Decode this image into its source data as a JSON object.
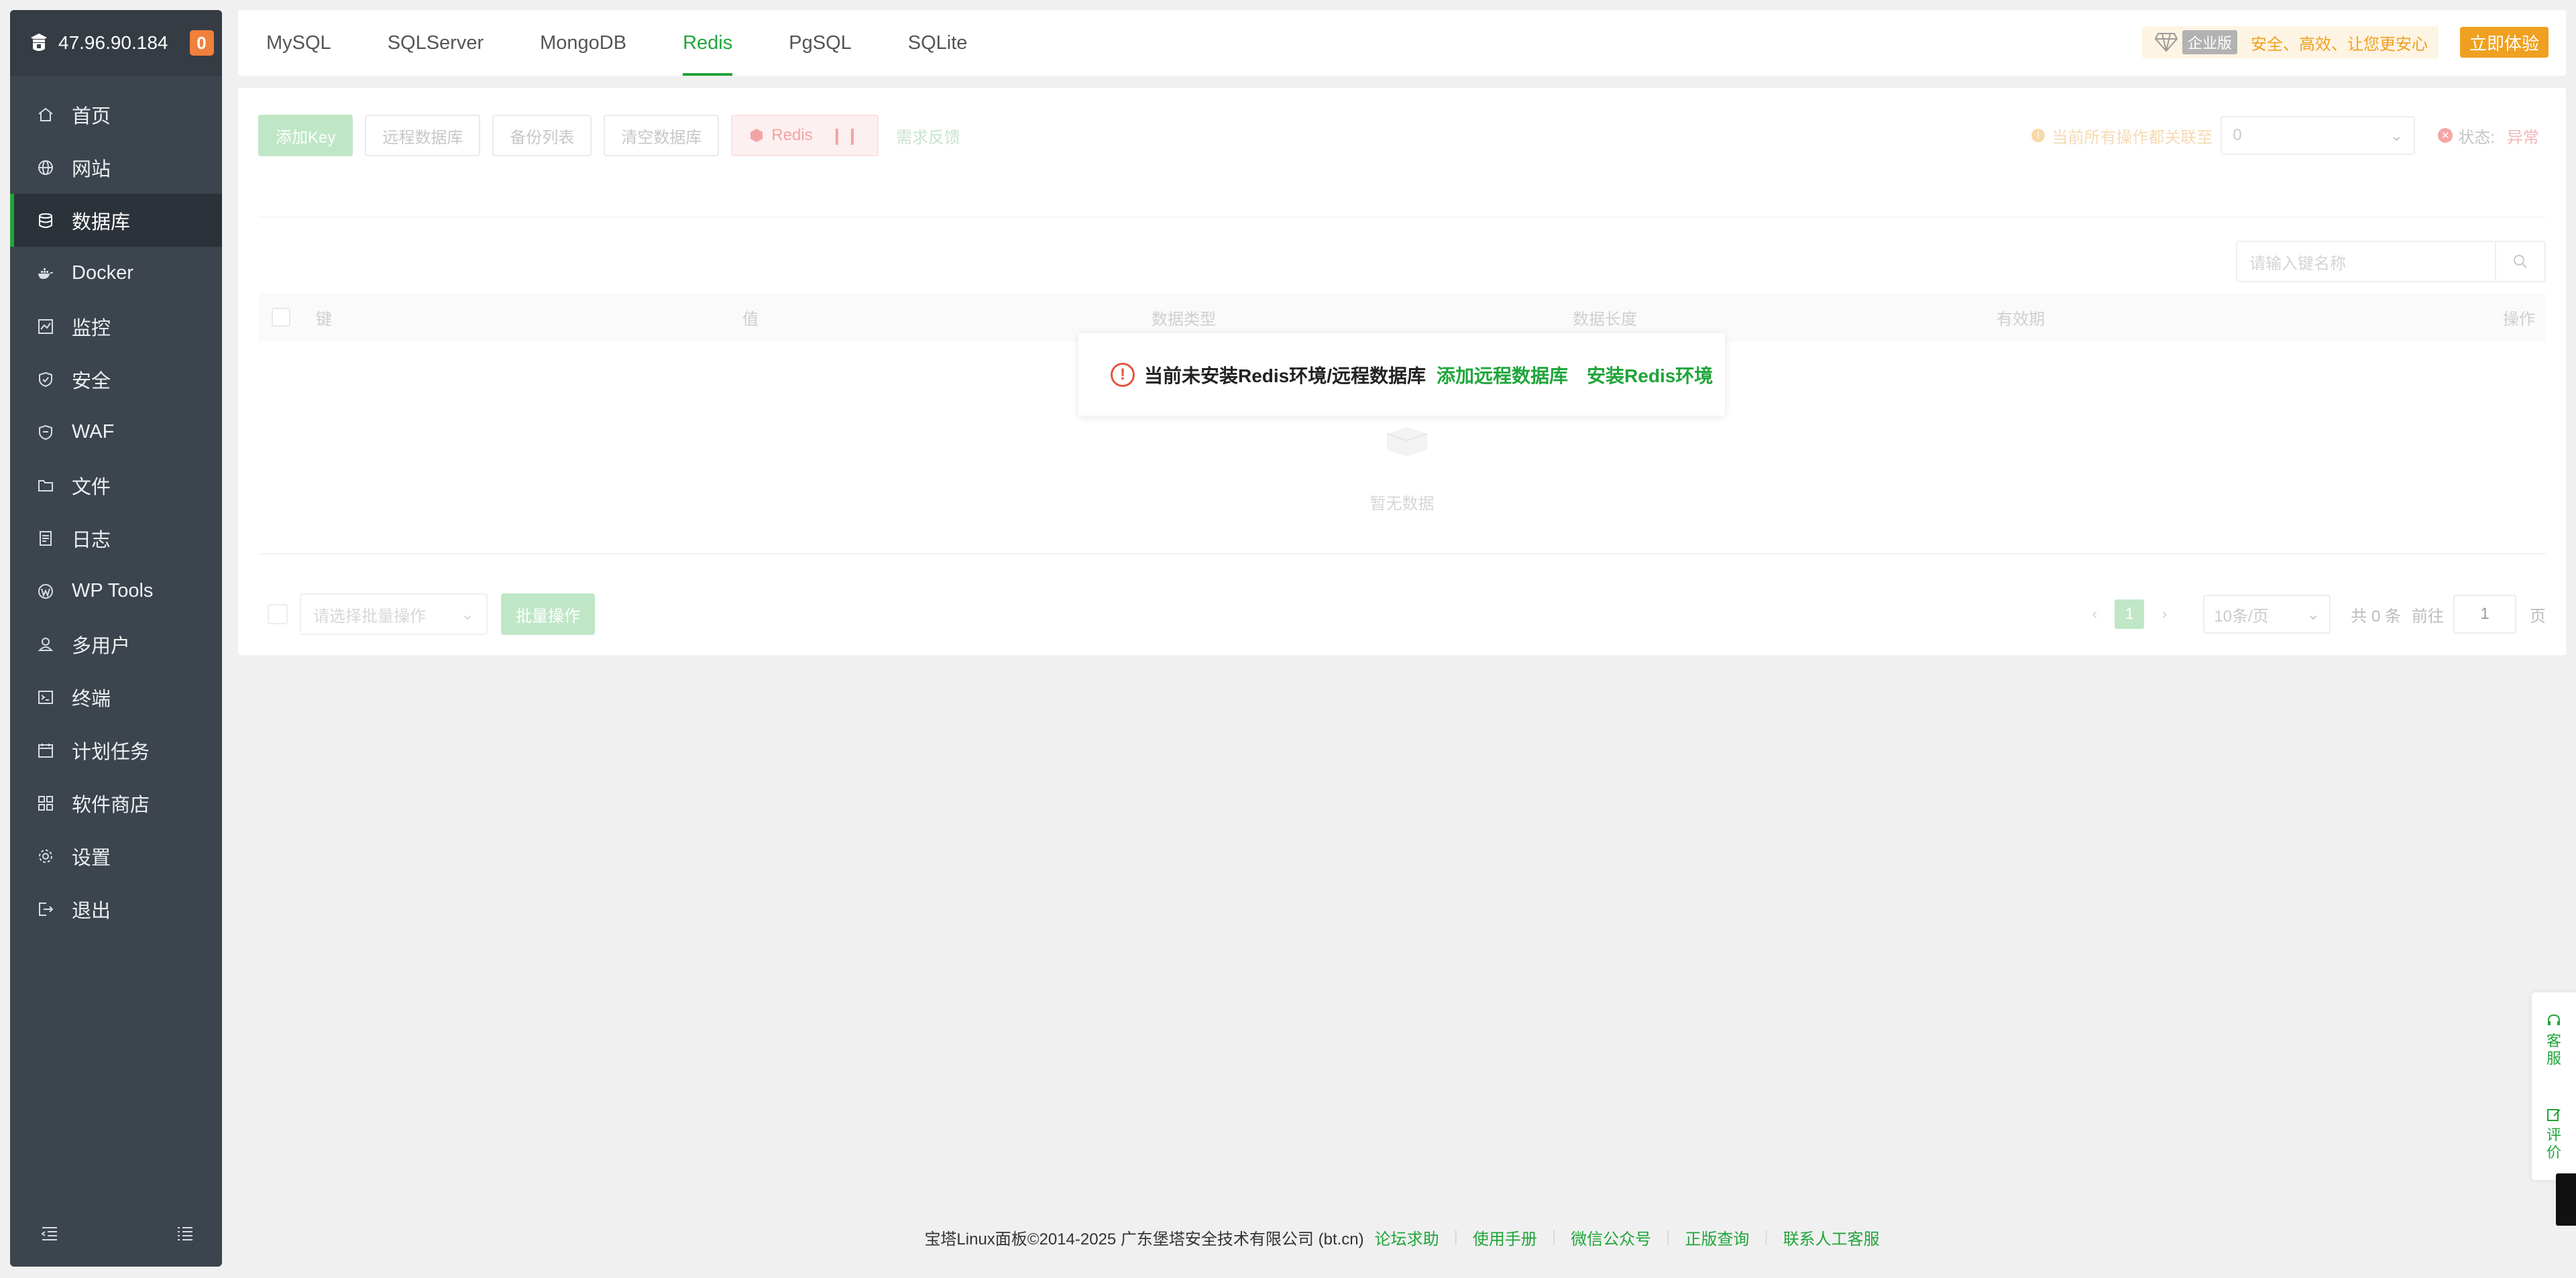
{
  "server": {
    "ip": "47.96.90.184",
    "notification_count": "0"
  },
  "sidebar": {
    "items": [
      {
        "label": "首页",
        "icon": "home-icon"
      },
      {
        "label": "网站",
        "icon": "globe-icon"
      },
      {
        "label": "数据库",
        "icon": "database-icon",
        "active": true
      },
      {
        "label": "Docker",
        "icon": "docker-icon"
      },
      {
        "label": "监控",
        "icon": "monitor-icon"
      },
      {
        "label": "安全",
        "icon": "shield-icon"
      },
      {
        "label": "WAF",
        "icon": "waf-shield-icon"
      },
      {
        "label": "文件",
        "icon": "folder-icon"
      },
      {
        "label": "日志",
        "icon": "log-icon"
      },
      {
        "label": "WP Tools",
        "icon": "wordpress-icon"
      },
      {
        "label": "多用户",
        "icon": "users-icon"
      },
      {
        "label": "终端",
        "icon": "terminal-icon"
      },
      {
        "label": "计划任务",
        "icon": "calendar-icon"
      },
      {
        "label": "软件商店",
        "icon": "grid-icon"
      },
      {
        "label": "设置",
        "icon": "gear-icon"
      },
      {
        "label": "退出",
        "icon": "logout-icon"
      }
    ]
  },
  "tabs": [
    {
      "label": "MySQL"
    },
    {
      "label": "SQLServer"
    },
    {
      "label": "MongoDB"
    },
    {
      "label": "Redis",
      "active": true
    },
    {
      "label": "PgSQL"
    },
    {
      "label": "SQLite"
    }
  ],
  "promo": {
    "edition": "企业版",
    "slogan": "安全、高效、让您更安心",
    "try_label": "立即体验"
  },
  "toolbar": {
    "add_key": "添加Key",
    "remote_db": "远程数据库",
    "backup_list": "备份列表",
    "clear_db": "清空数据库",
    "redis_label": "Redis",
    "feedback": "需求反馈"
  },
  "status": {
    "hint": "当前所有操作都关联至",
    "selected_db": "0",
    "state_label": "状态:",
    "state_value": "异常"
  },
  "search": {
    "placeholder": "请输入键名称"
  },
  "table": {
    "columns": [
      "键",
      "值",
      "数据类型",
      "数据长度",
      "有效期",
      "操作"
    ],
    "empty_text": "暂无数据"
  },
  "alert": {
    "message": "当前未安装Redis环境/远程数据库",
    "link_remote": "添加远程数据库",
    "link_install": "安装Redis环境"
  },
  "batch": {
    "select_placeholder": "请选择批量操作",
    "button": "批量操作"
  },
  "pagination": {
    "current_page": "1",
    "page_size": "10条/页",
    "total": "共 0 条",
    "goto_label": "前往",
    "goto_value": "1",
    "page_unit": "页"
  },
  "footer": {
    "copyright": "宝塔Linux面板©2014-2025 广东堡塔安全技术有限公司 (bt.cn)",
    "links": [
      "论坛求助",
      "使用手册",
      "微信公众号",
      "正版查询",
      "联系人工客服"
    ]
  },
  "float_panel": {
    "service": "客服",
    "review": "评价"
  },
  "colors": {
    "brand_green": "#20a53a",
    "sidebar_bg": "#3c444d",
    "warning_orange": "#f0803b",
    "error_red": "#e5563c"
  }
}
